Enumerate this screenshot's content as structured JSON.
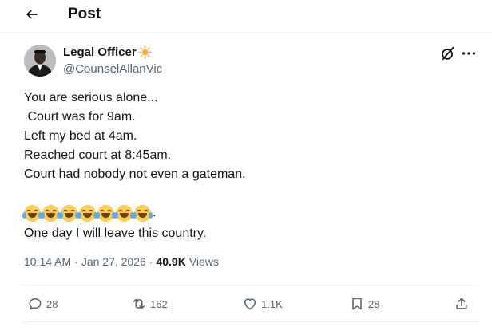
{
  "header": {
    "title": "Post",
    "back_icon": "arrow-left-icon"
  },
  "author": {
    "name": "Legal Officer",
    "name_emoji_icon": "sun-icon",
    "handle": "@CounselAllanVic",
    "avatar": "avatar"
  },
  "tweet": {
    "lines": [
      "You are serious alone...",
      " Court was for 9am.",
      "Left my bed at 4am.",
      "Reached court at 8:45am.",
      "Court had nobody not even a gateman."
    ],
    "emoji_icons": [
      "laughing-tears-emoji",
      "laughing-tears-emoji",
      "laughing-tears-emoji",
      "laughing-tears-emoji",
      "laughing-tears-emoji",
      "laughing-tears-emoji",
      "laughing-tears-emoji"
    ],
    "emoji_suffix": ".",
    "closing_line": "One day I will leave this country."
  },
  "meta": {
    "time": "10:14 AM",
    "separator": "·",
    "date": "Jan 27, 2026",
    "views_count": "40.9K",
    "views_label": "Views"
  },
  "actions": {
    "replies": "28",
    "reposts": "162",
    "likes": "1.1K",
    "bookmarks": "28"
  },
  "colors": {
    "text": "#0f1419",
    "secondary": "#536471",
    "divider": "#eff3f4",
    "emoji_face": "#ffcc4d",
    "sun": "#ffac33"
  }
}
